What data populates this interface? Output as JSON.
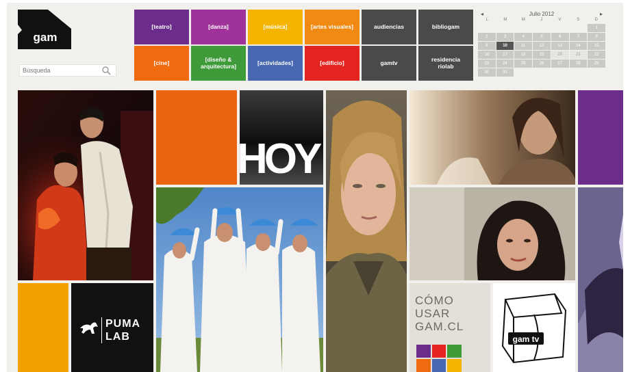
{
  "logo": {
    "text": "gam"
  },
  "search": {
    "placeholder": "Búsqueda"
  },
  "menu": [
    {
      "label": "[teatro]",
      "color": "#6b2c8c"
    },
    {
      "label": "[danza]",
      "color": "#a0339a"
    },
    {
      "label": "[música]",
      "color": "#f4b400"
    },
    {
      "label": "[artes visuales]",
      "color": "#f08a12"
    },
    {
      "label": "audiencias",
      "color": "#4a4a4a"
    },
    {
      "label": "bibliogam",
      "color": "#4a4a4a"
    },
    {
      "label": "[cine]",
      "color": "#f06a10"
    },
    {
      "label": "[diseño &\narquitectura]",
      "color": "#3f9a3a"
    },
    {
      "label": "[actividades]",
      "color": "#4767b0"
    },
    {
      "label": "[edificio]",
      "color": "#e32420"
    },
    {
      "label": "gamtv",
      "color": "#4a4a4a"
    },
    {
      "label": "residencia\nriolab",
      "color": "#4a4a4a"
    }
  ],
  "calendar": {
    "month": "Julio 2012",
    "prev": "◂",
    "next": "▸",
    "days": [
      "L",
      "M",
      "M",
      "J",
      "V",
      "S",
      "D"
    ],
    "leading_empty": 6,
    "count": 31,
    "today": 10
  },
  "tiles": {
    "hoy": "HOY",
    "puma": "PUMA\nLAB",
    "como": "CÓMO\nUSAR\nGAM.CL",
    "gamtv": "gam tv"
  },
  "colors": {
    "orange": "#ec6411",
    "purple": "#6b2c8c",
    "yellow": "#f4a000",
    "black": "#111111"
  }
}
